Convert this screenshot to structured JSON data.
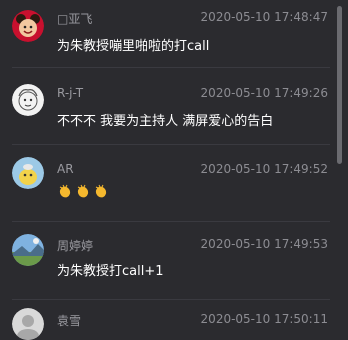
{
  "comments": [
    {
      "username": "□亚飞",
      "timestamp": "2020-05-10 17:48:47",
      "text": "为朱教授嘣里啪啦的打call",
      "avatar_icon": "red-mascot-avatar"
    },
    {
      "username": "R-j-T",
      "timestamp": "2020-05-10 17:49:26",
      "text": "不不不 我要为主持人 满屏爱心的告白",
      "avatar_icon": "white-sketch-avatar"
    },
    {
      "username": "AR",
      "timestamp": "2020-05-10 17:49:52",
      "text": "👏👏👏",
      "avatar_icon": "blue-cartoon-avatar"
    },
    {
      "username": "周婷婷",
      "timestamp": "2020-05-10 17:49:53",
      "text": "为朱教授打call+1",
      "avatar_icon": "scenery-photo-avatar"
    },
    {
      "username": "袁雪",
      "timestamp": "2020-05-10 17:50:11",
      "text": "",
      "avatar_icon": "gray-photo-avatar"
    }
  ],
  "colors": {
    "background": "#2b2b2f",
    "username": "#9a9aa0",
    "timestamp": "#8c8c92",
    "text": "#ffffff",
    "divider": "#3a3a40",
    "scrollbar": "#6b6b70"
  }
}
